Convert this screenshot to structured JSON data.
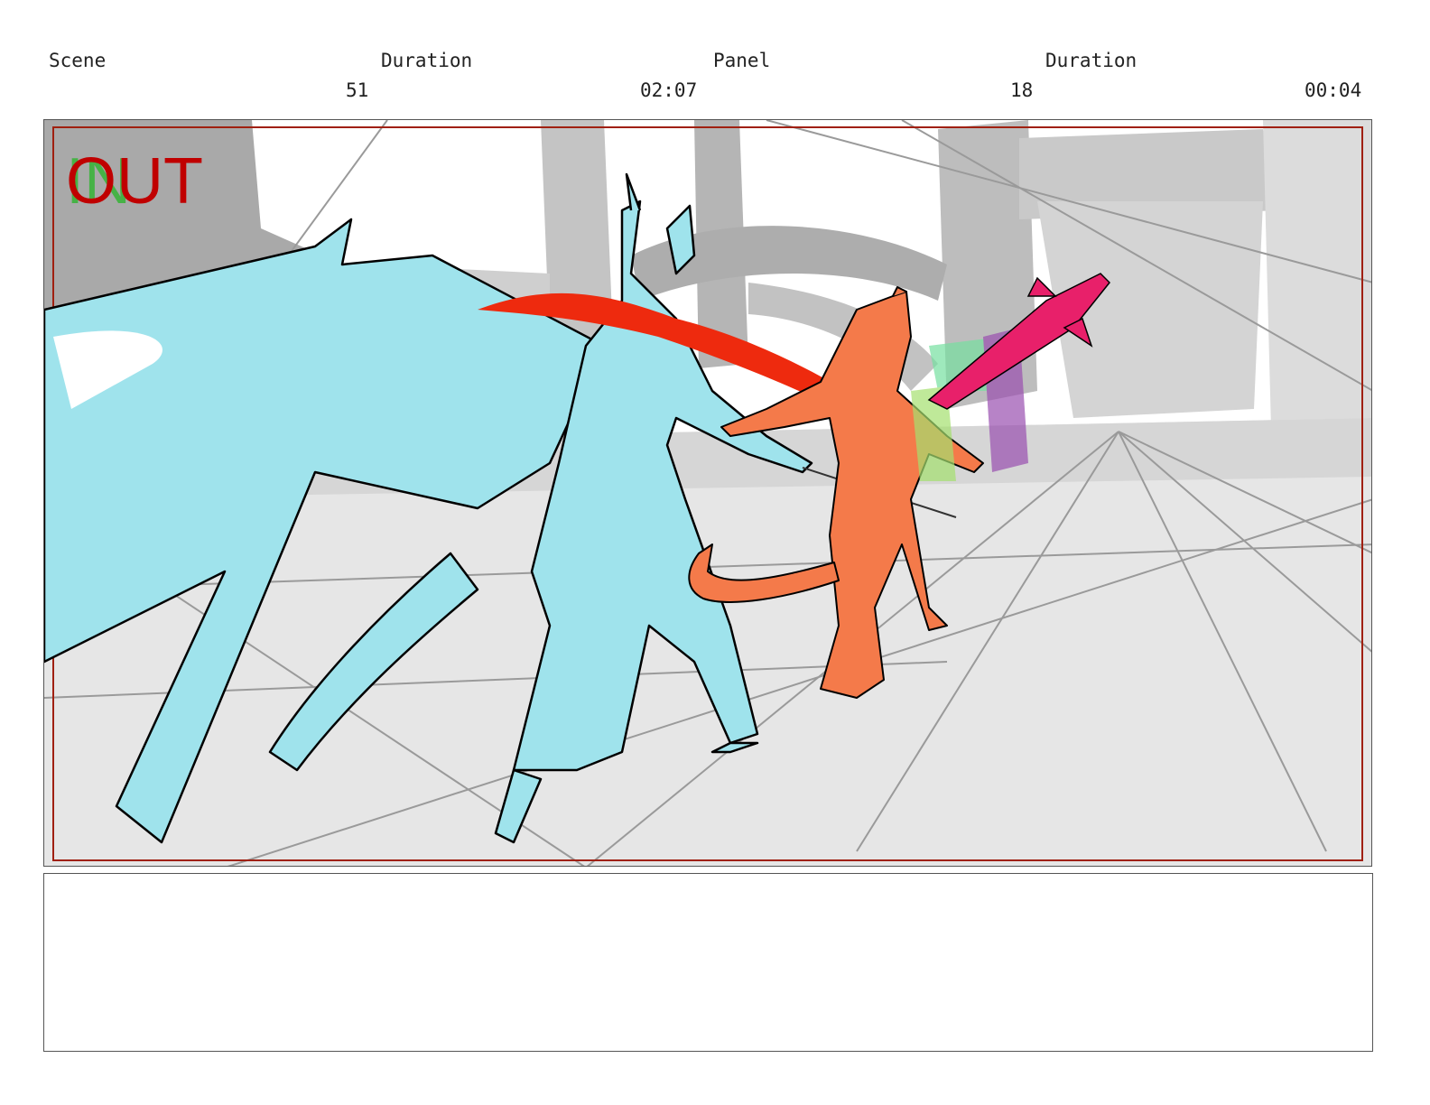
{
  "header": {
    "scene_label": "Scene",
    "scene_value": "51",
    "scene_duration_label": "Duration",
    "scene_duration_value": "02:07",
    "panel_label": "Panel",
    "panel_value": "18",
    "panel_duration_label": "Duration",
    "panel_duration_value": "00:04"
  },
  "panel_image": {
    "in_marker": "IN",
    "out_marker": "OUT",
    "colors": {
      "safe_area_border": "#a02010",
      "blue_character": "#9fe3ec",
      "orange_character": "#f47a4a",
      "red_scarf": "#ee2a0e",
      "pink_sword": "#e8206a",
      "background_gray": "#b9b9b9",
      "floor_gray": "#e6e6e6"
    }
  },
  "notes": {
    "text": ""
  }
}
